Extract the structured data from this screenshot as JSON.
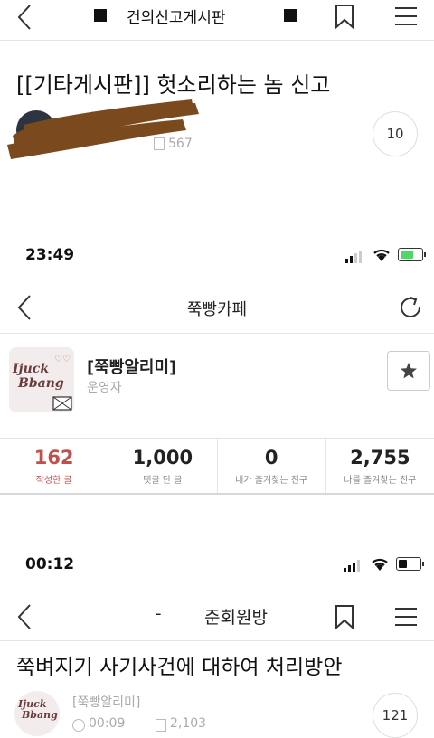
{
  "screen1": {
    "header_title": "건의신고게시판",
    "post_title": "[[기타게시판]] 헛소리하는 놈 신고",
    "views": "567",
    "comment_count": "10"
  },
  "screen2": {
    "status_time": "23:49",
    "header_title": "쭉빵카페",
    "profile_name": "[쭉빵알리미]",
    "profile_role": "운영자",
    "avatar_logo_line1": "Ijuck",
    "avatar_logo_line2": "Bbang",
    "stats": [
      {
        "value": "162",
        "label": "작성한 글",
        "color": "#c0504d"
      },
      {
        "value": "1,000",
        "label": "댓글 단 글",
        "color": "#222222"
      },
      {
        "value": "0",
        "label": "내가 즐겨찾는 친구",
        "color": "#222222"
      },
      {
        "value": "2,755",
        "label": "나를 즐겨찾는 친구",
        "color": "#222222"
      }
    ]
  },
  "screen3": {
    "status_time": "00:12",
    "header_dash": "-",
    "header_title": "준회원방",
    "post_title": "쭉벼지기 사기사건에 대하여 처리방안",
    "author": "[쭉빵알리미]",
    "time": "00:09",
    "views": "2,103",
    "comment_count": "121",
    "avatar_logo_line1": "Ijuck",
    "avatar_logo_line2": "Bbang"
  },
  "colors": {
    "accent_red": "#c0504d",
    "divider": "#e6e6e6",
    "battery_green": "#4cd964",
    "redaction": "#7a4a1e"
  }
}
